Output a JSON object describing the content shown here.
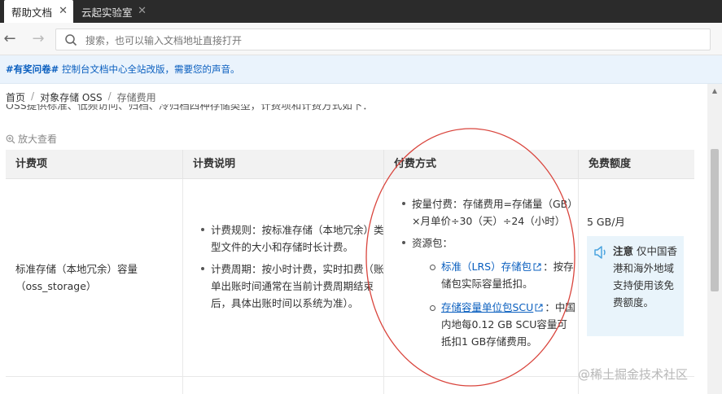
{
  "tabs": [
    {
      "label": "帮助文档",
      "close": "✕"
    },
    {
      "label": "云起实验室",
      "close": "✕"
    }
  ],
  "toolbar": {
    "back": "←",
    "forward": "→",
    "search_placeholder": "搜索，也可以输入文档地址直接打开"
  },
  "banner": {
    "tag": "#有奖问卷#",
    "text": "控制台文档中心全站改版，需要您的声音。"
  },
  "breadcrumb": {
    "items": [
      "首页",
      "对象存储 OSS",
      "存储费用"
    ],
    "sep": "/"
  },
  "cut_text": "OSS提供标准、低频访问、归档、冷归档四种存储类型，计费项和计费方式如下：",
  "zoom_label": "放大查看",
  "table": {
    "headers": [
      "计费项",
      "计费说明",
      "付费方式",
      "免费额度"
    ],
    "row": {
      "item_line1": "标准存储（本地冗余）容量",
      "item_line2": "（oss_storage）",
      "rule": "计费规则：按标准存储（本地冗余）类型文件的大小和存储时长计费。",
      "cycle": "计费周期：按小时计费，实时扣费（账单出账时间通常在当前计费周期结束后，具体出账时间以系统为准）。",
      "payg": "按量付费：存储费用=存储量（GB）×月单价÷30（天）÷24（小时）",
      "package": "资源包：",
      "lrs_link": "标准（LRS）存储包",
      "lrs_text": "：按存储包实际容量抵扣。",
      "scu_link": "存储容量单位包SCU",
      "scu_text": "：中国内地每0.12 GB SCU容量可抵扣1 GB存储费用。",
      "free": "5 GB/月",
      "note_title": "注意",
      "note_text": "仅中国香港和海外地域支持使用该免费额度。"
    }
  },
  "watermark": "@稀土掘金技术社区",
  "colors": {
    "link": "#0a5fbf",
    "annotation": "#d9443c",
    "banner_bg": "#eaf3fc"
  }
}
